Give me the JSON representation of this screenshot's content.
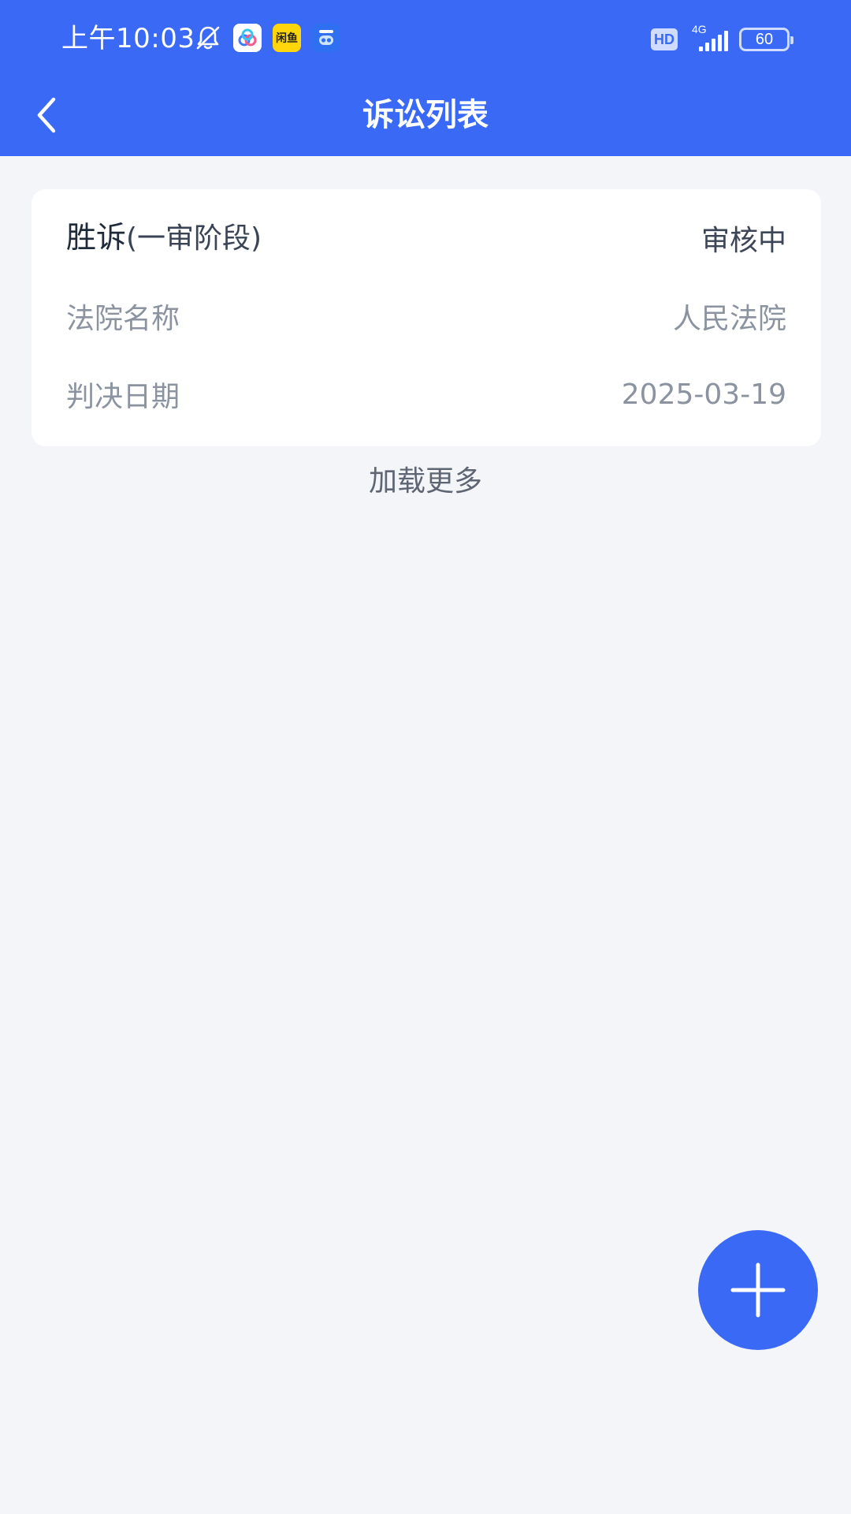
{
  "status_bar": {
    "time": "上午10:03",
    "icons": [
      "bell-off-icon",
      "baidu-netdisk-app-icon",
      "xianyu-app-icon",
      "autohome-app-icon"
    ],
    "xianyu_label": "闲鱼",
    "hd_badge": "HD",
    "network": "4G",
    "battery": "60"
  },
  "nav": {
    "title": "诉讼列表",
    "back_icon": "chevron-left-icon"
  },
  "records": [
    {
      "result": "胜诉",
      "stage": "(一审阶段)",
      "status": "审核中",
      "court_label": "法院名称",
      "court_value": "人民法院",
      "date_label": "判决日期",
      "date_value": "2025-03-19"
    }
  ],
  "load_more_label": "加载更多",
  "fab": {
    "icon": "plus-icon"
  },
  "colors": {
    "primary": "#3a6af5",
    "background": "#f3f5f9",
    "card": "#ffffff",
    "muted_text": "#8b93a0",
    "title_text": "#1f2a3a"
  }
}
